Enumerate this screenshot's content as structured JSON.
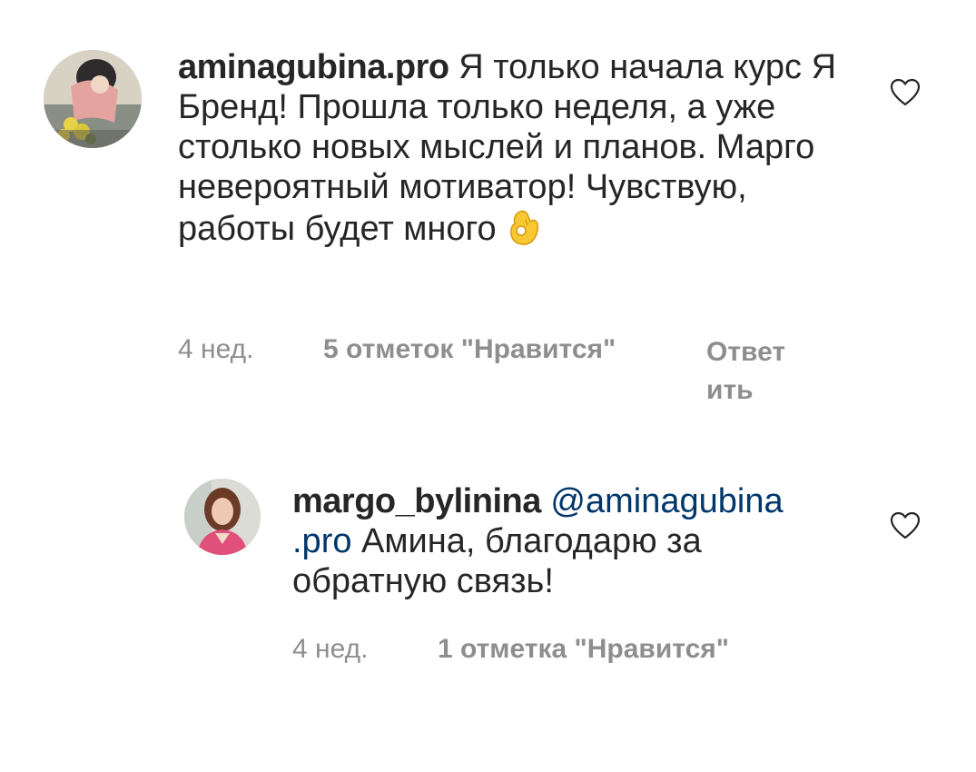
{
  "comments": [
    {
      "username": "aminagubina.pro",
      "text": " Я только начала курс Я Бренд! Прошла только неделя, а уже столько новых мыслей и планов. Марго невероятный мотиватор! Чувствую, работы будет много ",
      "emoji": "ok-hand-emoji",
      "time": "4 нед.",
      "likes": "5 отметок \"Нравится\"",
      "reply_line1": "Ответ",
      "reply_line2": "ить",
      "like_icon": "heart-outline-icon"
    },
    {
      "username": "margo_bylinina",
      "mention_line1": " @aminagubina",
      "mention_line2": ".pro",
      "text": " Амина, благодарю за обратную связь!",
      "time": "4 нед.",
      "likes": "1 отметка \"Нравится\"",
      "like_icon": "heart-outline-icon"
    }
  ],
  "colors": {
    "text": "#262626",
    "meta": "#8e8e8e",
    "mention": "#00376b"
  }
}
